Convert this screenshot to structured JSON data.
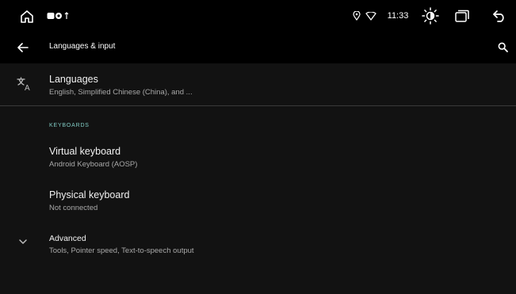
{
  "status_bar": {
    "time": "11:33",
    "icons": [
      "home-icon",
      "media-icon",
      "location-icon",
      "wifi-icon",
      "brightness-icon",
      "recent-apps-icon",
      "back-icon"
    ]
  },
  "app_bar": {
    "title": "Languages & input",
    "nav_icon": "back-arrow-icon",
    "action_icon": "search-icon"
  },
  "settings": {
    "languages": {
      "title": "Languages",
      "summary": "English, Simplified Chinese (China), and ..."
    },
    "keyboards_header": "KEYBOARDS",
    "virtual_keyboard": {
      "title": "Virtual keyboard",
      "summary": "Android Keyboard (AOSP)"
    },
    "physical_keyboard": {
      "title": "Physical keyboard",
      "summary": "Not connected"
    },
    "advanced": {
      "title": "Advanced",
      "summary": "Tools, Pointer speed, Text-to-speech output"
    }
  },
  "colors": {
    "background": "#121212",
    "bar": "#000000",
    "accent": "#80cbc4",
    "summary_text": "#a8a8a8"
  }
}
